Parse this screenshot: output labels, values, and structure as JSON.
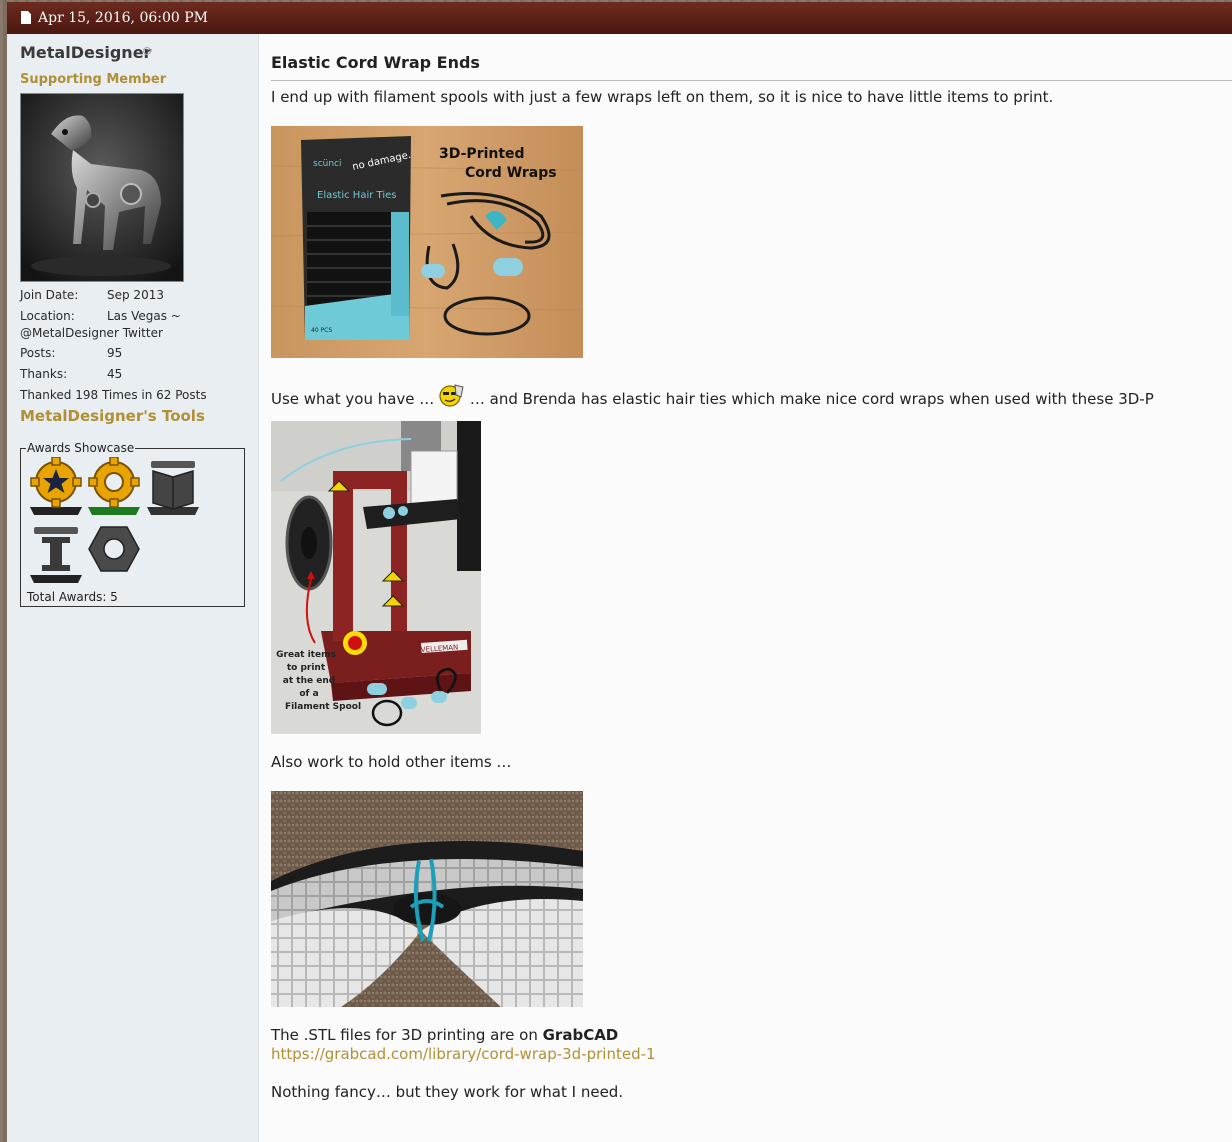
{
  "post": {
    "date": "Apr 15, 2016, 06:00 PM",
    "title": "Elastic Cord Wrap Ends",
    "paragraphs": {
      "intro": "I end up with filament spools with just a few wraps left on them, so it is nice to have little items to print.",
      "use_before": "Use what you have …",
      "use_after": "… and Brenda has elastic hair ties which make nice cord wraps when used with these 3D-P",
      "also": "Also work to hold other items …",
      "stl_prefix": "The .STL files for 3D printing are on ",
      "stl_bold": "GrabCAD",
      "closing": "Nothing fancy… but they work for what I need."
    },
    "link": "https://grabcad.com/library/cord-wrap-3d-printed-1",
    "images": {
      "img1_brand_line1": "scünci",
      "img1_damage": "no damage.",
      "img1_product": "Elastic Hair Ties",
      "img1_count": "40 PCS",
      "img1_caption_line1": "3D-Printed",
      "img1_caption_line2": "Cord Wraps",
      "img2_caption": [
        "Great items",
        "to print",
        "at the end",
        "of a",
        "Filament Spool"
      ],
      "img2_brand": "VELLEMAN"
    }
  },
  "user": {
    "name": "MetalDesigner",
    "title": "Supporting Member",
    "join_label": "Join Date:",
    "join_value": "Sep 2013",
    "location_label": "Location:",
    "location_value": "Las Vegas ~",
    "location_extra": "@MetalDesigner Twitter",
    "posts_label": "Posts:",
    "posts_value": "95",
    "thanks_label": "Thanks:",
    "thanks_value": "45",
    "thanked": "Thanked 198 Times in 62 Posts",
    "tools_link": "MetalDesigner's Tools",
    "awards_legend": "Awards Showcase",
    "awards_total": "Total Awards: 5"
  },
  "colors": {
    "header": "#5a2117",
    "gold_link": "#b18f34",
    "sidebar_bg": "#e9eef2"
  },
  "icons": {
    "header": "document-icon",
    "status": "offline-status-icon",
    "smiley": "cool-smiley-icon"
  }
}
